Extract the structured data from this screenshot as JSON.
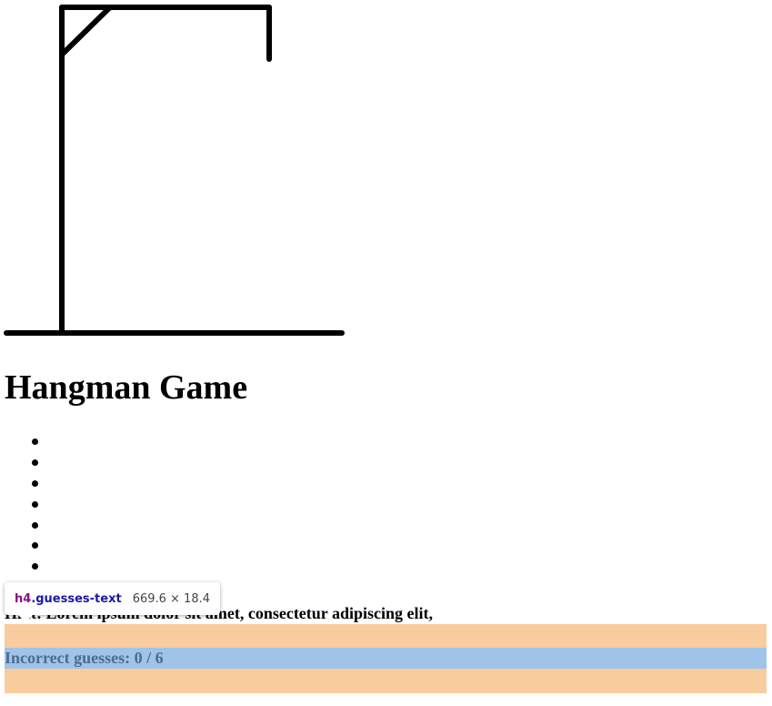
{
  "game": {
    "title": "Hangman Game",
    "word_slot_count": 7,
    "word_slots": [
      "",
      "",
      "",
      "",
      "",
      "",
      ""
    ],
    "hint_text": "Hint: Lorem ipsum dolor sit amet, consectetur adipiscing elit,",
    "guesses_text": "Incorrect guesses: 0 / 6",
    "incorrect_guesses": 0,
    "max_guesses": 6
  },
  "devtools_tooltip": {
    "tag": "h4",
    "class": ".guesses-text",
    "dimensions": "669.6 × 18.4"
  },
  "colors": {
    "margin_highlight": "#f9cc9d",
    "content_highlight": "#9fc4e7",
    "devtools_tag": "#881280",
    "devtools_class": "#1a1aa6"
  }
}
